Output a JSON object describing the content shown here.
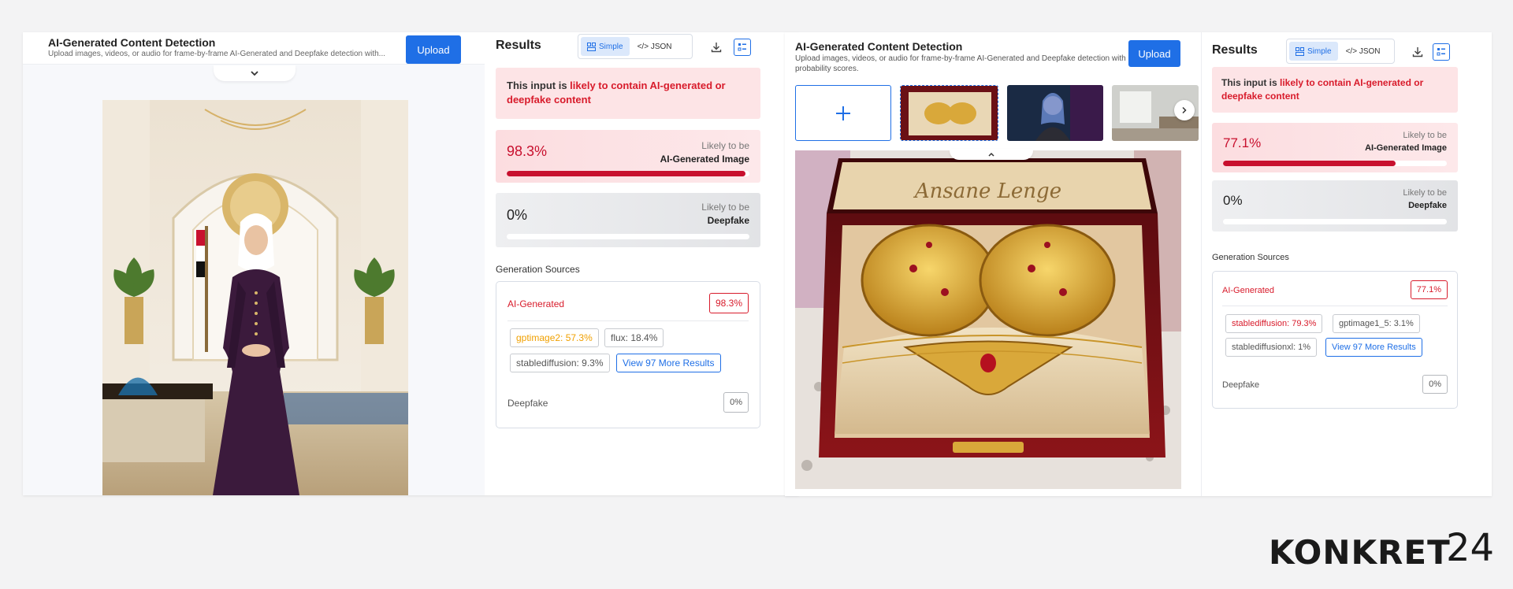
{
  "left": {
    "app_title": "AI-Generated Content Detection",
    "app_desc": "Upload images, videos, or audio for frame-by-frame AI-Generated and Deepfake detection with...",
    "upload_label": "Upload",
    "results": {
      "title": "Results",
      "toggle_simple": "Simple",
      "toggle_json": "</> JSON",
      "verdict_prefix": "This input is ",
      "verdict_highlight": "likely to contain AI-generated or deepfake content",
      "ai_score": {
        "value": "98.3%",
        "fraction": 0.983,
        "label_top": "Likely to be",
        "label_bottom": "AI-Generated Image"
      },
      "deepfake_score": {
        "value": "0%",
        "fraction": 0.0,
        "label_top": "Likely to be",
        "label_bottom": "Deepfake"
      },
      "gen_sources_title": "Generation Sources",
      "ai_label": "AI-Generated",
      "ai_pct": "98.3%",
      "chips": [
        "gptimage2: 57.3%",
        "flux: 18.4%",
        "stablediffusion: 9.3%"
      ],
      "more_label": "View 97 More Results",
      "deepfake_label": "Deepfake",
      "deepfake_pct": "0%"
    }
  },
  "right": {
    "app_title": "AI-Generated Content Detection",
    "app_desc": "Upload images, videos, or audio for frame-by-frame AI-Generated and Deepfake detection with probability scores.",
    "upload_label": "Upload",
    "results": {
      "title": "Results",
      "toggle_simple": "Simple",
      "toggle_json": "</> JSON",
      "verdict_prefix": "This input is ",
      "verdict_highlight": "likely to contain AI-generated or deepfake content",
      "ai_score": {
        "value": "77.1%",
        "fraction": 0.771,
        "label_top": "Likely to be",
        "label_bottom": "AI-Generated Image"
      },
      "deepfake_score": {
        "value": "0%",
        "fraction": 0.0,
        "label_top": "Likely to be",
        "label_bottom": "Deepfake"
      },
      "gen_sources_title": "Generation Sources",
      "ai_label": "AI-Generated",
      "ai_pct": "77.1%",
      "chips": [
        "stablediffusion: 79.3%",
        "gptimage1_5: 3.1%",
        "stablediffusionxl: 1%"
      ],
      "more_label": "View 97 More Results",
      "deepfake_label": "Deepfake",
      "deepfake_pct": "0%"
    }
  },
  "brand": {
    "logo_text": "KONKRET24"
  },
  "colors": {
    "accent": "#1f6fe6",
    "alert_red": "#d81b2b",
    "alert_bg": "#fde4e6",
    "chip_orange": "#f0a000"
  },
  "icons": [
    "chevron-down-icon",
    "chevron-up-icon",
    "chevron-right-icon",
    "plus-icon",
    "download-icon",
    "layout-icon",
    "list-icon"
  ]
}
